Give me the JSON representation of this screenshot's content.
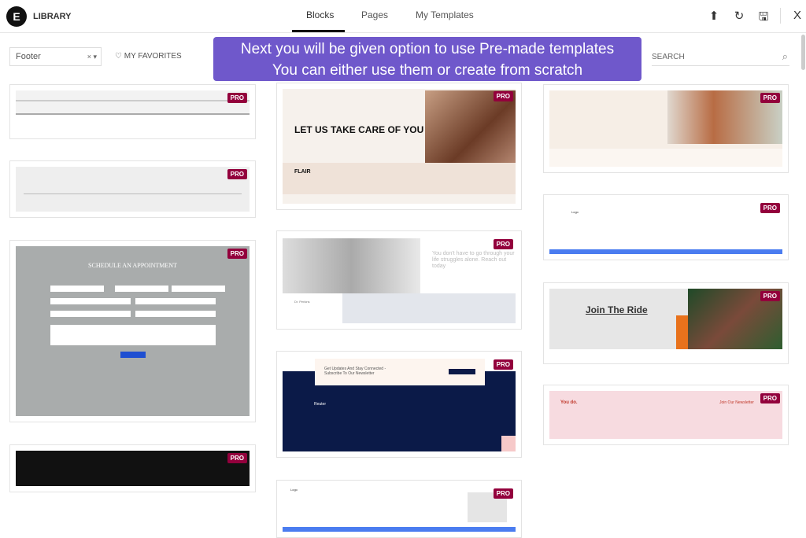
{
  "header": {
    "logo": "E",
    "title": "LIBRARY",
    "tabs": [
      {
        "label": "Blocks",
        "active": true
      },
      {
        "label": "Pages"
      },
      {
        "label": "My Templates"
      }
    ],
    "icons": [
      "upload-icon",
      "sync-icon",
      "save-icon",
      "close-icon"
    ],
    "close": "X"
  },
  "toolbar": {
    "filter_value": "Footer",
    "filter_clear": "×",
    "filter_caret": "▾",
    "favorites_label": "MY FAVORITES",
    "search_placeholder": "SEARCH"
  },
  "tooltip": {
    "line1": "Next you will be given option to use Pre-made templates",
    "line2": "You can either use them or create from scratch"
  },
  "badge": "PRO",
  "templates": {
    "appointment_title": "SCHEDULE AN APPOINTMENT",
    "flair_headline": "LET US TAKE CARE OF YOU",
    "flair_logo": "FLAIR",
    "therapy_headline": "You don't have to go through your life struggles alone. Reach out today",
    "therapy_name": "Dr. Perkins",
    "newsletter_headline": "Get Updates And Stay Connected - Subscribe To Our Newsletter",
    "newsletter_brand": "Reuter",
    "logo_text": "Logo",
    "ride_headline": "Join The Ride",
    "youdo_brand": "You do.",
    "youdo_newsletter": "Join Our Newsletter"
  },
  "colors": {
    "accent": "#6f58cb",
    "pro": "#93003c",
    "navy": "#0b1a48",
    "blue": "#4a7cf0",
    "orange": "#e8721c",
    "pink": "#f7dbe0"
  }
}
